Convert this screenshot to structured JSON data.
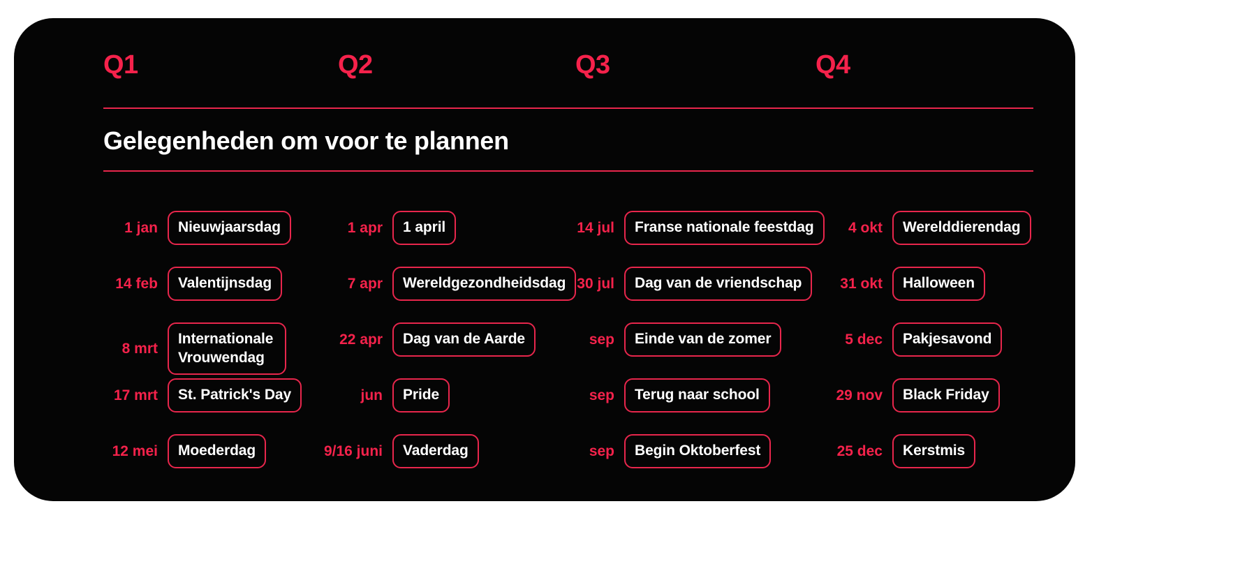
{
  "card": {
    "accent_color": "#F5224B",
    "border_color": "#E8264C",
    "background_color": "#050505",
    "text_color": "#FFFFFF",
    "title": "Gelegenheden om voor te plannen"
  },
  "quarters": [
    {
      "label": "Q1"
    },
    {
      "label": "Q2"
    },
    {
      "label": "Q3"
    },
    {
      "label": "Q4"
    }
  ],
  "columns": [
    {
      "quarter": "Q1",
      "entries": [
        {
          "date": "1 jan",
          "occasion": "Nieuwjaarsdag"
        },
        {
          "date": "14 feb",
          "occasion": "Valentijnsdag"
        },
        {
          "date": "8 mrt",
          "occasion": "Internationale Vrouwendag",
          "lines": 2
        },
        {
          "date": "17 mrt",
          "occasion": "St. Patrick's Day"
        },
        {
          "date": "12 mei",
          "occasion": "Moederdag"
        }
      ]
    },
    {
      "quarter": "Q2",
      "entries": [
        {
          "date": "1 apr",
          "occasion": "1 april"
        },
        {
          "date": "7 apr",
          "occasion": "Wereldgezondheidsdag"
        },
        {
          "date": "22 apr",
          "occasion": "Dag van de Aarde"
        },
        {
          "date": "jun",
          "occasion": "Pride"
        },
        {
          "date": "9/16 juni",
          "occasion": "Vaderdag"
        }
      ]
    },
    {
      "quarter": "Q3",
      "entries": [
        {
          "date": "14 jul",
          "occasion": "Franse nationale feestdag"
        },
        {
          "date": "30 jul",
          "occasion": "Dag van de vriendschap"
        },
        {
          "date": "sep",
          "occasion": "Einde van de zomer"
        },
        {
          "date": "sep",
          "occasion": "Terug naar school"
        },
        {
          "date": "sep",
          "occasion": "Begin Oktoberfest"
        }
      ]
    },
    {
      "quarter": "Q4",
      "entries": [
        {
          "date": "4 okt",
          "occasion": "Werelddierendag"
        },
        {
          "date": "31 okt",
          "occasion": "Halloween"
        },
        {
          "date": "5 dec",
          "occasion": "Pakjesavond"
        },
        {
          "date": "29 nov",
          "occasion": "Black Friday"
        },
        {
          "date": "25 dec",
          "occasion": "Kerstmis"
        }
      ]
    }
  ]
}
